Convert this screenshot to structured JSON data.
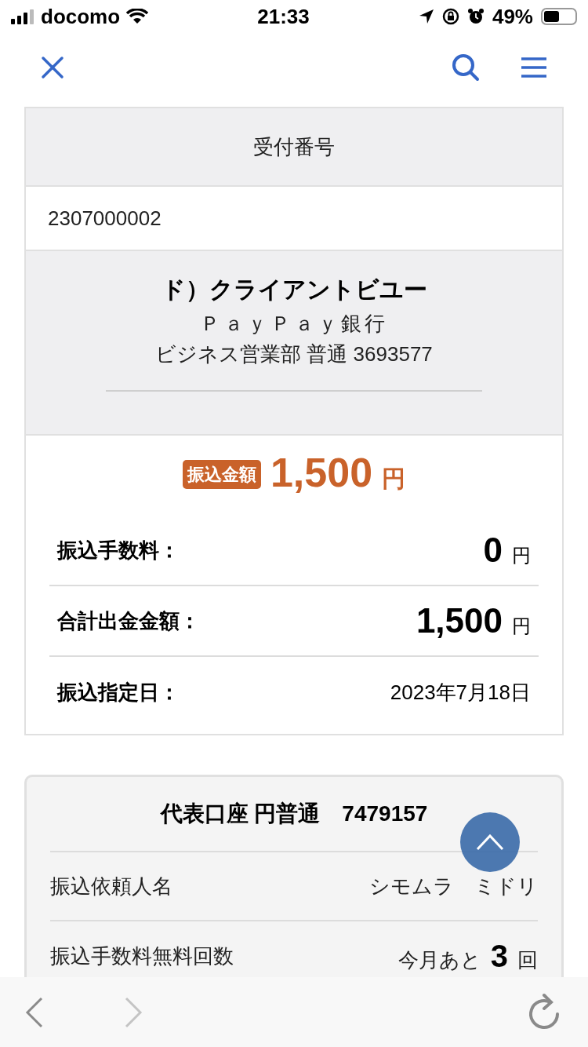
{
  "status_bar": {
    "carrier": "docomo",
    "time": "21:33",
    "battery": "49%"
  },
  "receipt": {
    "number_label": "受付番号",
    "number": "2307000002"
  },
  "payee": {
    "name": "ド）クライアントビユー",
    "bank": "ＰａｙＰａｙ銀行",
    "branch_account": "ビジネス営業部 普通 3693577"
  },
  "transfer": {
    "badge": "振込金額",
    "amount": "1,500",
    "unit": "円",
    "rows": [
      {
        "kind": "amount",
        "label": "振込手数料：",
        "value": "0",
        "unit": "円"
      },
      {
        "kind": "amount",
        "label": "合計出金金額：",
        "value": "1,500",
        "unit": "円"
      },
      {
        "kind": "text",
        "label": "振込指定日：",
        "value": "2023年7月18日"
      }
    ]
  },
  "account": {
    "title": "代表口座 円普通　7479157",
    "rows": [
      {
        "kind": "text",
        "label": "振込依頼人名",
        "value": "シモムラ　ミドリ"
      },
      {
        "kind": "count",
        "label": "振込手数料無料回数",
        "prefix": "今月あと",
        "value": "3",
        "unit": "回"
      }
    ]
  }
}
